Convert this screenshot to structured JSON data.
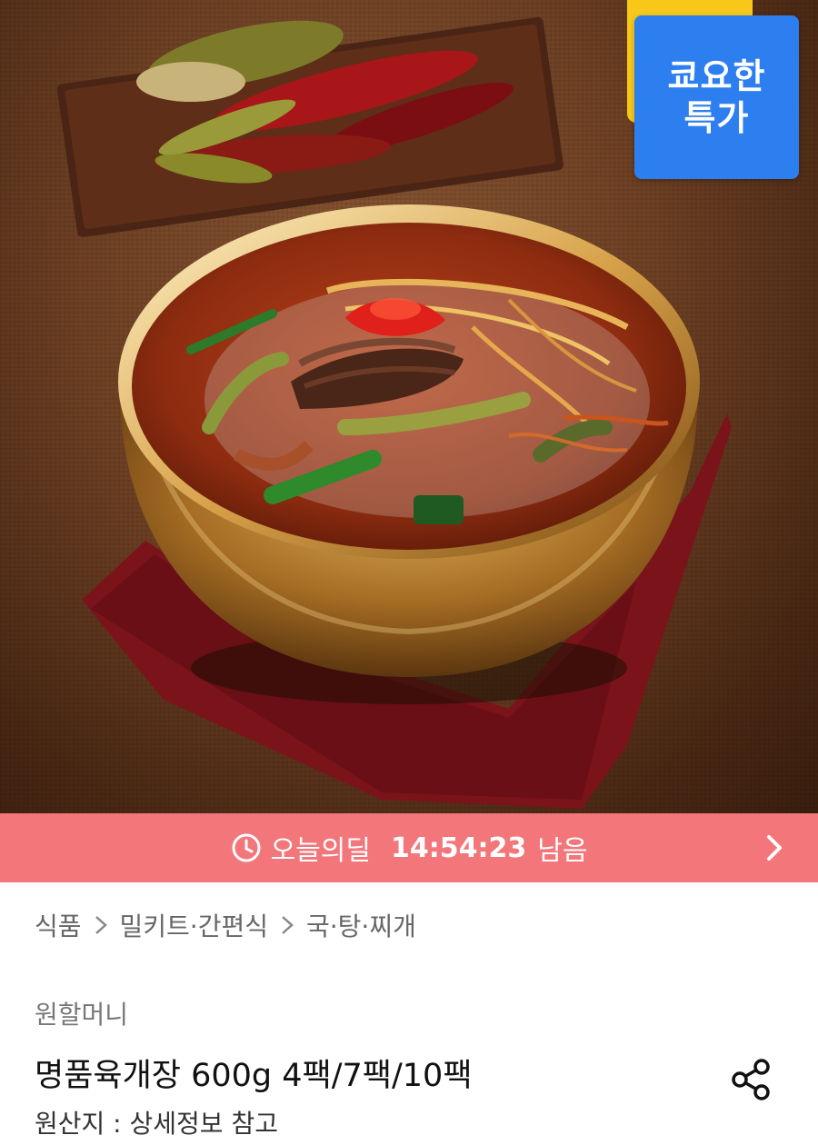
{
  "badge": {
    "line1": "쿄요한",
    "line2": "특가",
    "color": "#2d7ff0",
    "back_color": "#f7c81a"
  },
  "deal": {
    "icon": "clock-icon",
    "label": "오늘의딜",
    "time_remaining": "14:54:23",
    "suffix": "남음",
    "color": "#f2767a",
    "arrow_icon": "chevron-right-icon"
  },
  "breadcrumb": {
    "items": [
      "식품",
      "밀키트·간편식",
      "국·탕·찌개"
    ],
    "separator_icon": "chevron-right-icon"
  },
  "product": {
    "brand": "원할머니",
    "title": "명품육개장 600g 4팩/7팩/10팩",
    "origin": "원산지 : 상세정보 참고",
    "share_icon": "share-icon"
  }
}
